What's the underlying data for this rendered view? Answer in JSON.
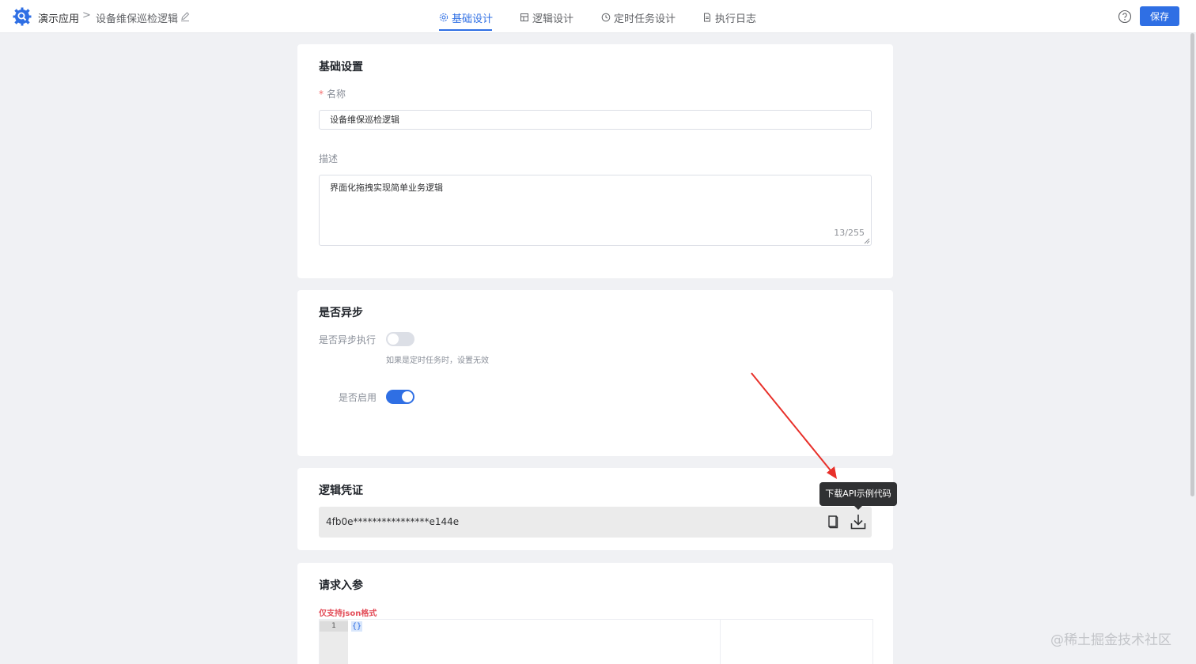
{
  "header": {
    "app_name": "演示应用",
    "separator": ">",
    "page_name": "设备维保巡检逻辑",
    "tabs": [
      {
        "label": "基础设计",
        "icon": "gear-icon",
        "active": true
      },
      {
        "label": "逻辑设计",
        "icon": "layout-icon",
        "active": false
      },
      {
        "label": "定时任务设计",
        "icon": "clock-icon",
        "active": false
      },
      {
        "label": "执行日志",
        "icon": "document-icon",
        "active": false
      }
    ],
    "save_label": "保存"
  },
  "basic": {
    "title": "基础设置",
    "name_label": "名称",
    "name_value": "设备维保巡检逻辑",
    "desc_label": "描述",
    "desc_value": "界面化拖拽实现简单业务逻辑",
    "desc_count": "13/255"
  },
  "async": {
    "title": "是否异步",
    "async_label": "是否异步执行",
    "async_on": false,
    "async_hint": "如果是定时任务时，设置无效",
    "enable_label": "是否启用",
    "enable_on": true
  },
  "credential": {
    "title": "逻辑凭证",
    "token": "4fb0e****************e144e",
    "tooltip": "下载API示例代码"
  },
  "request": {
    "title": "请求入参",
    "note": "仅支持json格式",
    "line_number": "1",
    "code": "{}"
  },
  "watermark": "@稀土掘金技术社区",
  "colors": {
    "accent": "#2f6fe4",
    "required": "#f56c6c",
    "note_red": "#e34d59",
    "annotation_arrow": "#e8302a"
  }
}
